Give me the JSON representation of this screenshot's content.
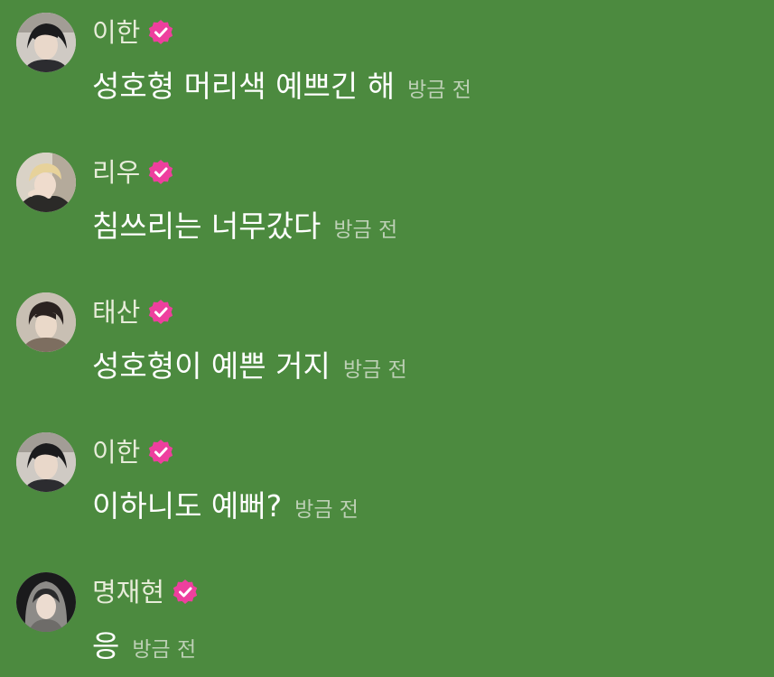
{
  "colors": {
    "background": "#4c8a3f",
    "badge": "#ee3f9e",
    "name_text": "#e7ecd9",
    "message_text": "#ffffff",
    "timestamp_text": "#bdd0b5"
  },
  "messages": [
    {
      "author": "이한",
      "text": "성호형 머리색 예쁘긴 해",
      "time": "방금 전",
      "verified": true
    },
    {
      "author": "리우",
      "text": "침쓰리는 너무갔다",
      "time": "방금 전",
      "verified": true
    },
    {
      "author": "태산",
      "text": "성호형이 예쁜 거지",
      "time": "방금 전",
      "verified": true
    },
    {
      "author": "이한",
      "text": "이하니도 예뻐?",
      "time": "방금 전",
      "verified": true
    },
    {
      "author": "명재현",
      "text": "응",
      "time": "방금 전",
      "verified": true
    }
  ]
}
